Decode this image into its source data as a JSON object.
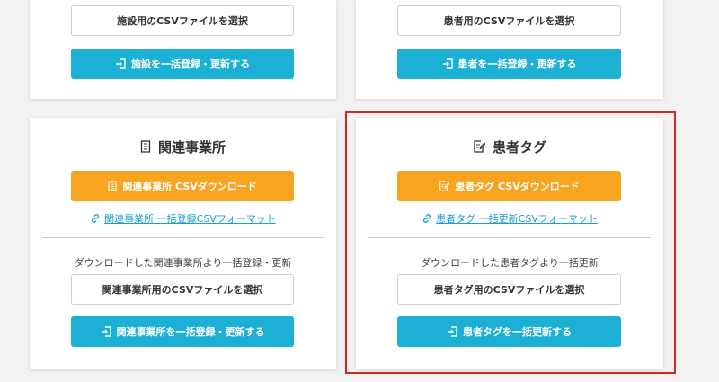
{
  "facility": {
    "select_file_label": "施設用のCSVファイルを選択",
    "register_label": "施設を一括登録・更新する"
  },
  "patient": {
    "select_file_label": "患者用のCSVファイルを選択",
    "register_label": "患者を一括登録・更新する"
  },
  "related_office": {
    "title": "関連事業所",
    "download_label": "関連事業所 CSVダウンロード",
    "format_link": "関連事業所 一括登録CSVフォーマット",
    "description": "ダウンロードした関連事業所より一括登録・更新",
    "select_file_label": "関連事業所用のCSVファイルを選択",
    "register_label": "関連事業所を一括登録・更新する"
  },
  "patient_tag": {
    "title": "患者タグ",
    "download_label": "患者タグ CSVダウンロード",
    "format_link": "患者タグ 一括更新CSVフォーマット",
    "description": "ダウンロードした患者タグより一括更新",
    "select_file_label": "患者タグ用のCSVファイルを選択",
    "register_label": "患者タグを一括更新する"
  },
  "colors": {
    "blue": "#1cb0d4",
    "orange": "#f7a521",
    "link": "#1a9fd0",
    "highlight": "#d9232a"
  }
}
